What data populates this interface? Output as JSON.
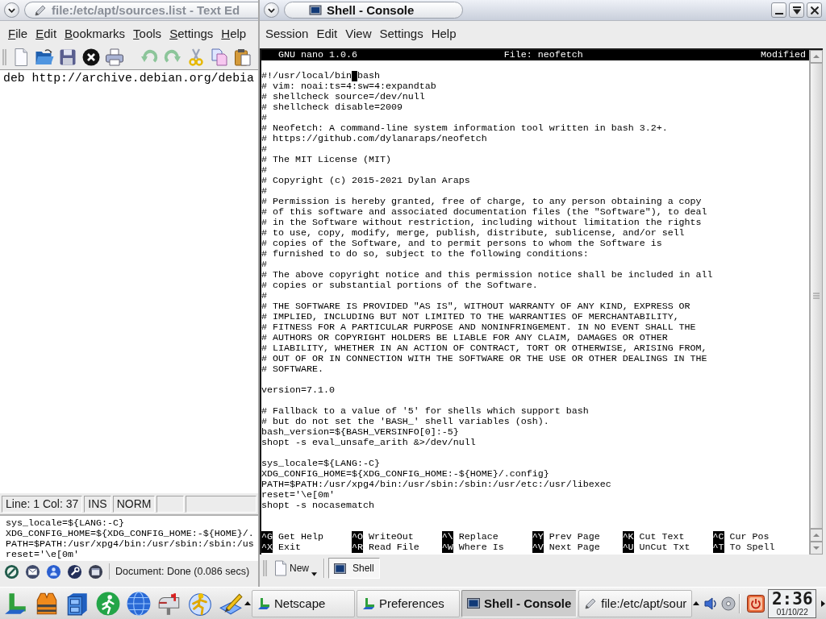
{
  "text_editor_window": {
    "title": "file:/etc/apt/sources.list - Text Ed",
    "active": false,
    "menu": [
      {
        "label": "File",
        "mnemonic_underlined": true
      },
      {
        "label": "Edit",
        "mnemonic_underlined": true
      },
      {
        "label": "Bookmarks",
        "mnemonic_underlined": true
      },
      {
        "label": "Tools",
        "mnemonic_underlined": true
      },
      {
        "label": "Settings",
        "mnemonic_underlined": true
      },
      {
        "label": "Help",
        "mnemonic_underlined": true
      }
    ],
    "content": "deb http://archive.debian.org/debia",
    "status_fields": [
      "Line: 1 Col: 37",
      "INS",
      "NORM"
    ]
  },
  "browser_window": {
    "lines": [
      "sys_locale=${LANG:-C}",
      "XDG_CONFIG_HOME=${XDG_CONFIG_HOME:-${HOME}/.",
      "PATH=$PATH:/usr/xpg4/bin:/usr/sbin:/sbin:/us",
      "reset='\\e[0m'"
    ],
    "status": "Document: Done (0.086 secs)"
  },
  "console_window": {
    "title": "Shell - Console",
    "active": true,
    "menu": [
      "Session",
      "Edit",
      "View",
      "Settings",
      "Help"
    ],
    "nano": {
      "version": "GNU nano 1.0.6",
      "file": "File: neofetch",
      "state": "Modified",
      "cursor_line": {
        "before": "#!/usr/local/bin",
        "after": "bash"
      },
      "blocks": [
        [
          "# vim: noai:ts=4:sw=4:expandtab",
          "# shellcheck source=/dev/null",
          "# shellcheck disable=2009",
          "#",
          "# Neofetch: A command-line system information tool written in bash 3.2+.",
          "# https://github.com/dylanaraps/neofetch",
          "#",
          "# The MIT License (MIT)",
          "#",
          "# Copyright (c) 2015-2021 Dylan Araps",
          "#",
          "# Permission is hereby granted, free of charge, to any person obtaining a copy",
          "# of this software and associated documentation files (the \"Software\"), to deal",
          "# in the Software without restriction, including without limitation the rights",
          "# to use, copy, modify, merge, publish, distribute, sublicense, and/or sell",
          "# copies of the Software, and to permit persons to whom the Software is",
          "# furnished to do so, subject to the following conditions:",
          "#",
          "# The above copyright notice and this permission notice shall be included in all",
          "# copies or substantial portions of the Software.",
          "#",
          "# THE SOFTWARE IS PROVIDED \"AS IS\", WITHOUT WARRANTY OF ANY KIND, EXPRESS OR",
          "# IMPLIED, INCLUDING BUT NOT LIMITED TO THE WARRANTIES OF MERCHANTABILITY,",
          "# FITNESS FOR A PARTICULAR PURPOSE AND NONINFRINGEMENT. IN NO EVENT SHALL THE",
          "# AUTHORS OR COPYRIGHT HOLDERS BE LIABLE FOR ANY CLAIM, DAMAGES OR OTHER",
          "# LIABILITY, WHETHER IN AN ACTION OF CONTRACT, TORT OR OTHERWISE, ARISING FROM,",
          "# OUT OF OR IN CONNECTION WITH THE SOFTWARE OR THE USE OR OTHER DEALINGS IN THE",
          "# SOFTWARE."
        ],
        [
          "version=7.1.0"
        ],
        [
          "# Fallback to a value of '5' for shells which support bash",
          "# but do not set the 'BASH_' shell variables (osh).",
          "bash_version=${BASH_VERSINFO[0]:-5}",
          "shopt -s eval_unsafe_arith &>/dev/null"
        ],
        [
          "sys_locale=${LANG:-C}",
          "XDG_CONFIG_HOME=${XDG_CONFIG_HOME:-${HOME}/.config}",
          "PATH=$PATH:/usr/xpg4/bin:/usr/sbin:/sbin:/usr/etc:/usr/libexec",
          "reset='\\e[0m'",
          "shopt -s nocasematch"
        ]
      ],
      "shortcuts": [
        {
          "key": "^G",
          "label": "Get Help"
        },
        {
          "key": "^O",
          "label": "WriteOut"
        },
        {
          "key": "^\\",
          "label": "Replace"
        },
        {
          "key": "^Y",
          "label": "Prev Page"
        },
        {
          "key": "^K",
          "label": "Cut Text"
        },
        {
          "key": "^C",
          "label": "Cur Pos"
        },
        {
          "key": "^X",
          "label": "Exit"
        },
        {
          "key": "^R",
          "label": "Read File"
        },
        {
          "key": "^W",
          "label": "Where Is"
        },
        {
          "key": "^V",
          "label": "Next Page"
        },
        {
          "key": "^U",
          "label": "UnCut Txt"
        },
        {
          "key": "^T",
          "label": "To Spell"
        }
      ]
    },
    "new_button": "New",
    "sessions": [
      {
        "label": "Shell",
        "selected": true
      }
    ]
  },
  "taskbar": {
    "tasks": [
      {
        "label": "Netscape",
        "kind": "app",
        "selected": false
      },
      {
        "label": "Preferences",
        "kind": "app",
        "selected": false
      },
      {
        "label": "Shell - Console",
        "kind": "terminal",
        "selected": true
      },
      {
        "label": "file:/etc/apt/sour",
        "kind": "editor",
        "selected": false
      }
    ],
    "clock": {
      "time": "2:36",
      "date": "01/10/22"
    }
  }
}
